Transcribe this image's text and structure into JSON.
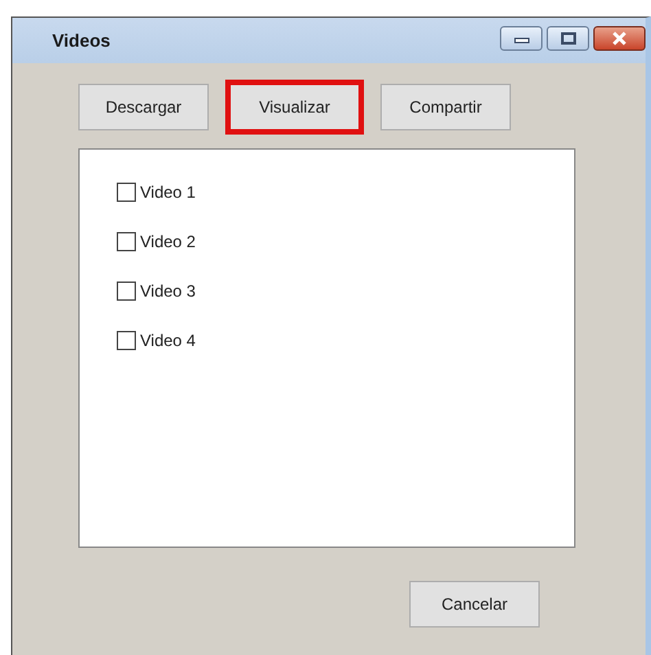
{
  "window": {
    "title": "Videos"
  },
  "toolbar_buttons": [
    {
      "label": "Descargar",
      "highlighted": false
    },
    {
      "label": "Visualizar",
      "highlighted": true
    },
    {
      "label": "Compartir",
      "highlighted": false
    }
  ],
  "videos": [
    {
      "label": "Video 1",
      "checked": false
    },
    {
      "label": "Video 2",
      "checked": false
    },
    {
      "label": "Video 3",
      "checked": false
    },
    {
      "label": "Video 4",
      "checked": false
    }
  ],
  "buttons": [
    "Cancelar"
  ]
}
